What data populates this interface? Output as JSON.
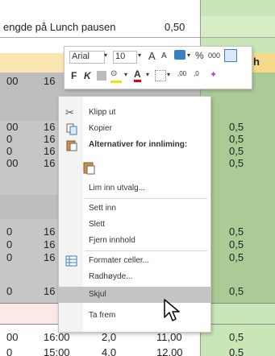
{
  "sheet": {
    "header_text": "engde på Lunch pausen",
    "header_value": "0,50",
    "col_h": "h",
    "rows": [
      {
        "a": "00",
        "b": "16"
      },
      {
        "a": "00",
        "b": "16",
        "c": "0,5"
      },
      {
        "a": "0",
        "b": "16",
        "c": "0,5"
      },
      {
        "a": "0",
        "b": "16",
        "c": "0,5"
      },
      {
        "a": "00",
        "b": "16",
        "c": "0,5"
      },
      {
        "a": "0",
        "b": "16",
        "c": "0,5"
      },
      {
        "a": "0",
        "b": "16",
        "c": "0,5"
      },
      {
        "a": "0",
        "b": "16",
        "c": "0,5"
      },
      {
        "a": "0",
        "b": "16",
        "c": "0,5"
      },
      {
        "a": "00",
        "b": "16:00",
        "d": "2,0",
        "e": "11,00",
        "c": "0,5"
      },
      {
        "a": "0",
        "b": "15:00",
        "d": "4,0",
        "e": "12,00",
        "c": "0,5"
      }
    ]
  },
  "toolbar": {
    "font": "Arial",
    "size": "10",
    "grow_font": "A",
    "shrink_font": "A",
    "percent": "%",
    "thousands": "000",
    "bold": "F",
    "italic": "K"
  },
  "menu": {
    "cut": "Klipp ut",
    "copy": "Kopier",
    "paste_options": "Alternativer for innliming:",
    "paste_special": "Lim inn utvalg...",
    "insert": "Sett inn",
    "delete": "Slett",
    "clear": "Fjern innhold",
    "format_cells": "Formater celler...",
    "row_height": "Radhøyde...",
    "hide": "Skjul",
    "unhide": "Ta frem"
  }
}
